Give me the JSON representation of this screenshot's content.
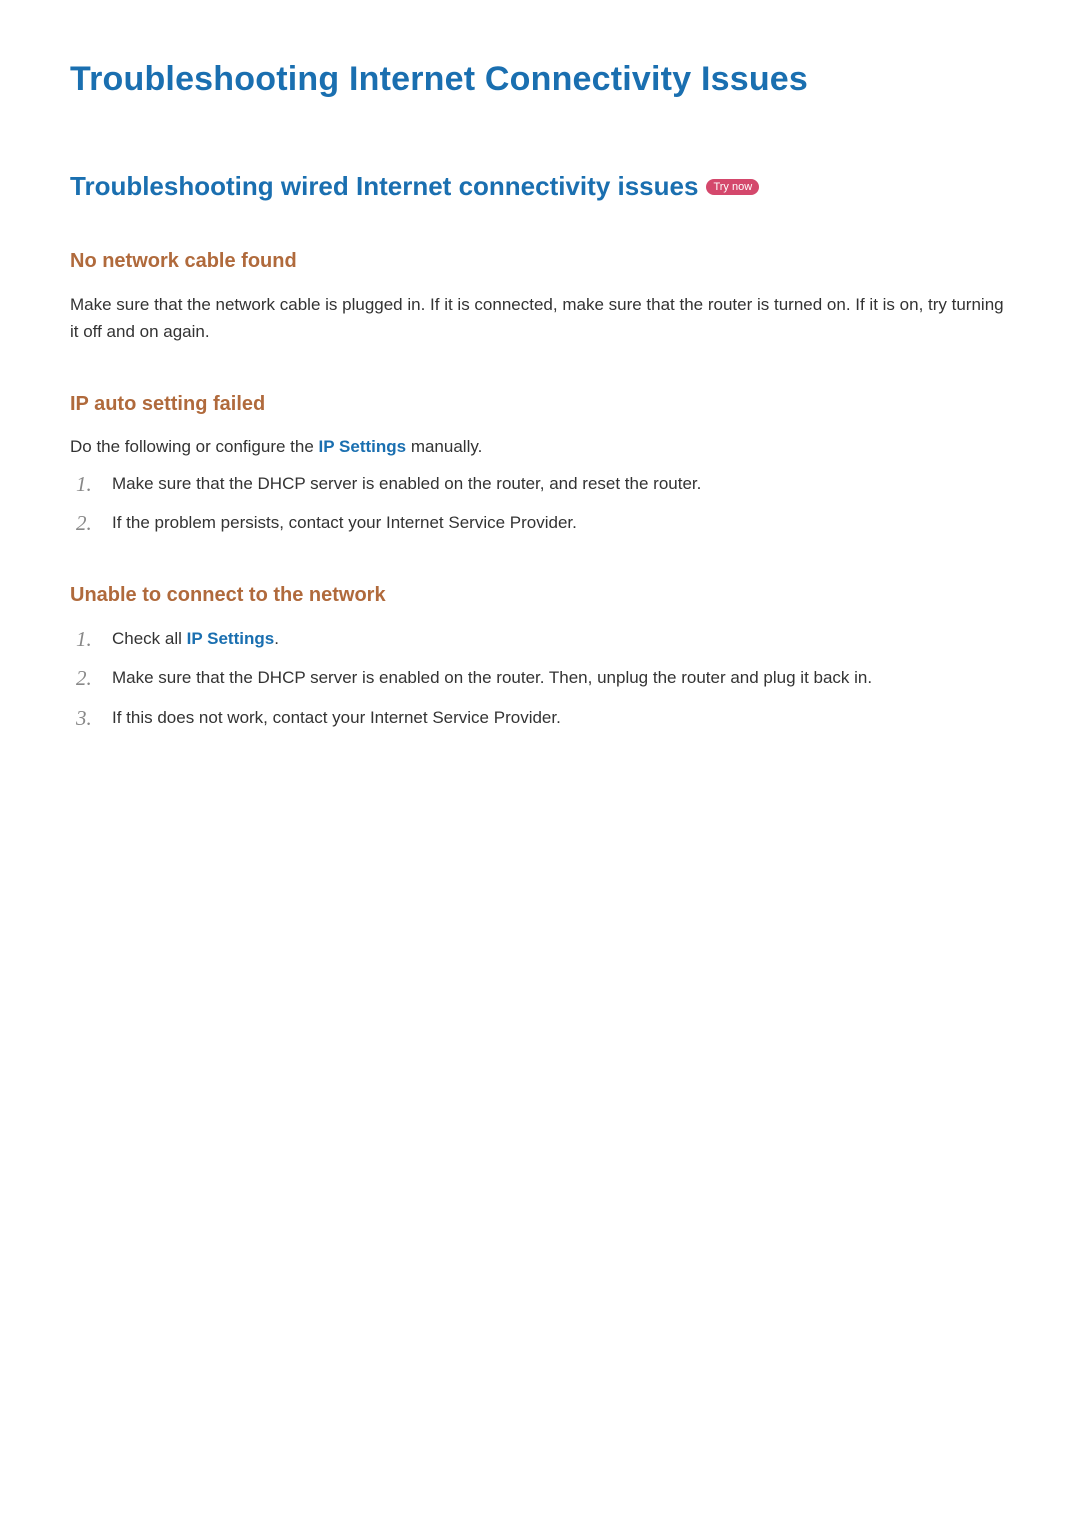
{
  "page": {
    "title": "Troubleshooting Internet Connectivity Issues"
  },
  "section1": {
    "title": "Troubleshooting wired Internet connectivity issues",
    "badge": "Try now"
  },
  "block1": {
    "heading": "No network cable found",
    "text": "Make sure that the network cable is plugged in. If it is connected, make sure that the router is turned on. If it is on, try turning it off and on again."
  },
  "block2": {
    "heading": "IP auto setting failed",
    "intro_pre": "Do the following or configure the ",
    "intro_bold": "IP Settings",
    "intro_post": " manually.",
    "items": [
      "Make sure that the DHCP server is enabled on the router, and reset the router.",
      "If the problem persists, contact your Internet Service Provider."
    ]
  },
  "block3": {
    "heading": "Unable to connect to the network",
    "item1_pre": "Check all ",
    "item1_bold": "IP Settings",
    "item1_post": ".",
    "item2": "Make sure that the DHCP server is enabled on the router. Then, unplug the router and plug it back in.",
    "item3": "If this does not work, contact your Internet Service Provider."
  }
}
